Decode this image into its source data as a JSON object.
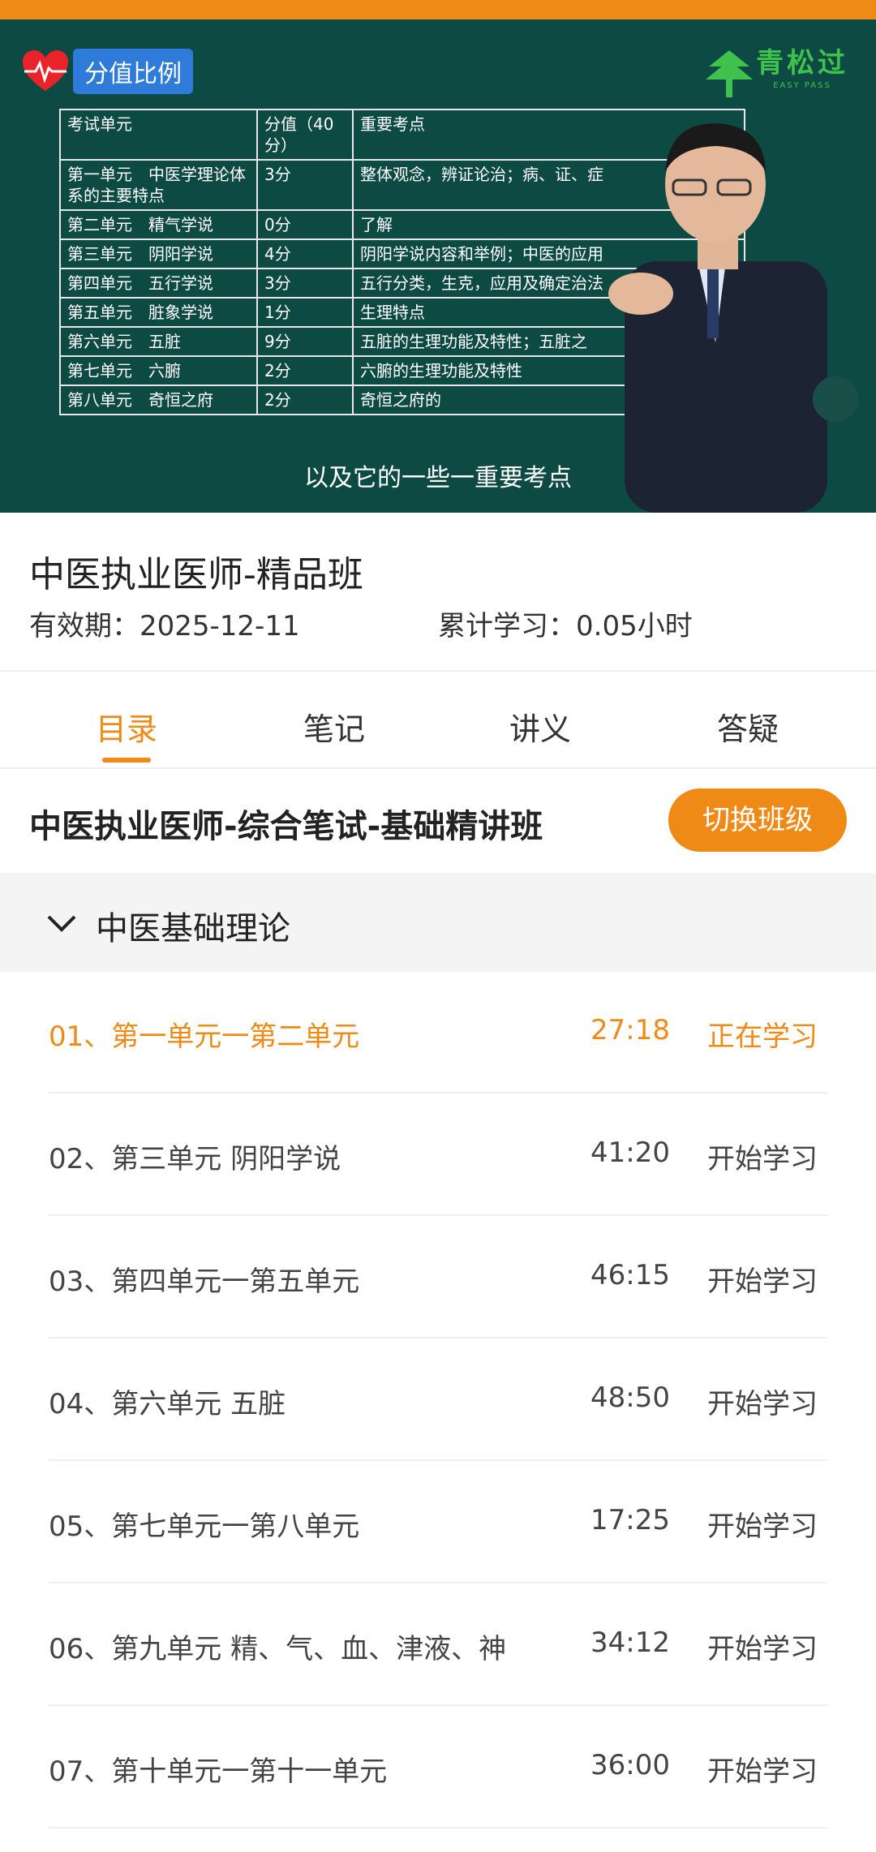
{
  "video": {
    "badge_label": "分值比例",
    "logo_text": "青松过",
    "logo_sub": "EASY PASS",
    "table_header": [
      "考试单元",
      "分值（40分）",
      "重要考点"
    ],
    "table_rows": [
      [
        "第一单元　中医学理论体系的主要特点",
        "3分",
        "整体观念，辨证论治；病、证、症"
      ],
      [
        "第二单元　精气学说",
        "0分",
        "了解"
      ],
      [
        "第三单元　阴阳学说",
        "4分",
        "阴阳学说内容和举例；中医的应用"
      ],
      [
        "第四单元　五行学说",
        "3分",
        "五行分类，生克，应用及确定治法"
      ],
      [
        "第五单元　脏象学说",
        "1分",
        "生理特点"
      ],
      [
        "第六单元　五脏",
        "9分",
        "五脏的生理功能及特性；五脏之"
      ],
      [
        "第七单元　六腑",
        "2分",
        "六腑的生理功能及特性"
      ],
      [
        "第八单元　奇恒之府",
        "2分",
        "奇恒之府的"
      ]
    ],
    "subtitle": "以及它的一些一重要考点"
  },
  "course": {
    "title": "中医执业医师-精品班",
    "validity": "有效期：2025-12-11",
    "study_time": "累计学习：0.05小时"
  },
  "tabs": [
    {
      "label": "目录",
      "active": true
    },
    {
      "label": "笔记",
      "active": false
    },
    {
      "label": "讲义",
      "active": false
    },
    {
      "label": "答疑",
      "active": false
    }
  ],
  "class": {
    "title": "中医执业医师-综合笔试-基础精讲班",
    "switch_label": "切换班级"
  },
  "chapter": {
    "title": "中医基础理论",
    "icon": "chevron-down-icon"
  },
  "lessons": [
    {
      "title": "01、第一单元一第二单元",
      "duration": "27:18",
      "action": "正在学习",
      "current": true
    },
    {
      "title": "02、第三单元 阴阳学说",
      "duration": "41:20",
      "action": "开始学习",
      "current": false
    },
    {
      "title": "03、第四单元一第五单元",
      "duration": "46:15",
      "action": "开始学习",
      "current": false
    },
    {
      "title": "04、第六单元 五脏",
      "duration": "48:50",
      "action": "开始学习",
      "current": false
    },
    {
      "title": "05、第七单元一第八单元",
      "duration": "17:25",
      "action": "开始学习",
      "current": false
    },
    {
      "title": "06、第九单元 精、气、血、津液、神",
      "duration": "34:12",
      "action": "开始学习",
      "current": false
    },
    {
      "title": "07、第十单元一第十一单元",
      "duration": "36:00",
      "action": "开始学习",
      "current": false
    }
  ],
  "colors": {
    "accent": "#f08a16",
    "video_bg": "#0e4a44",
    "badge_blue": "#2f7bd9",
    "logo_green": "#3fc24c"
  }
}
